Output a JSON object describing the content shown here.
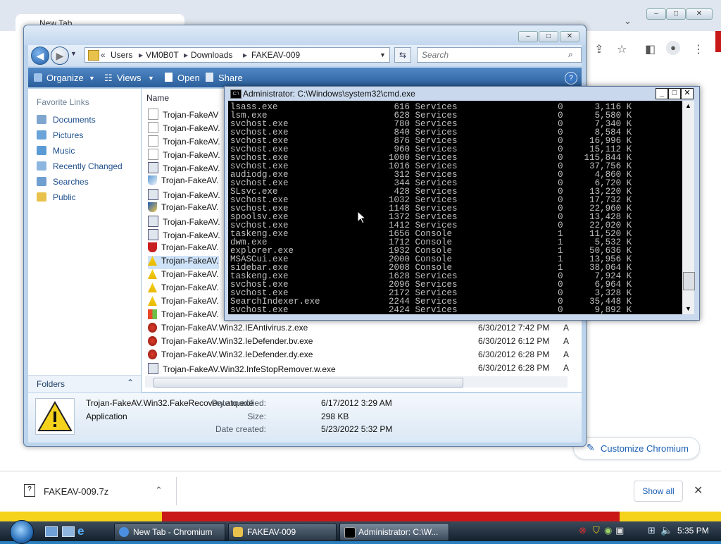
{
  "chrome": {
    "tab_title": "New Tab",
    "customize_label": "Customize Chromium",
    "download_file": "FAKEAV-009.7z",
    "show_all_label": "Show all"
  },
  "explorer": {
    "path": [
      "Users",
      "VM0B0T",
      "Downloads",
      "FAKEAV-009"
    ],
    "search_placeholder": "Search",
    "toolbar": {
      "organize": "Organize",
      "views": "Views",
      "open": "Open",
      "share": "Share"
    },
    "favorites_title": "Favorite Links",
    "favorites": [
      "Documents",
      "Pictures",
      "Music",
      "Recently Changed",
      "Searches",
      "Public"
    ],
    "folders_label": "Folders",
    "column_name": "Name",
    "files": [
      {
        "name": "Trojan-FakeAV",
        "date": "",
        "attr": "",
        "icon": "generic-file-icon"
      },
      {
        "name": "Trojan-FakeAV.",
        "date": "",
        "attr": "",
        "icon": "generic-file-icon"
      },
      {
        "name": "Trojan-FakeAV.",
        "date": "",
        "attr": "",
        "icon": "generic-file-icon"
      },
      {
        "name": "Trojan-FakeAV.",
        "date": "",
        "attr": "",
        "icon": "generic-file-icon"
      },
      {
        "name": "Trojan-FakeAV.",
        "date": "",
        "attr": "",
        "icon": "app-window-icon"
      },
      {
        "name": "Trojan-FakeAV.",
        "date": "",
        "attr": "",
        "icon": "shield-icon"
      },
      {
        "name": "Trojan-FakeAV.",
        "date": "",
        "attr": "",
        "icon": "app-window-icon"
      },
      {
        "name": "Trojan-FakeAV.",
        "date": "",
        "attr": "",
        "icon": "security-shield-icon"
      },
      {
        "name": "Trojan-FakeAV.",
        "date": "",
        "attr": "",
        "icon": "app-window-icon"
      },
      {
        "name": "Trojan-FakeAV.",
        "date": "",
        "attr": "",
        "icon": "app-window-icon"
      },
      {
        "name": "Trojan-FakeAV.",
        "date": "",
        "attr": "",
        "icon": "red-shield-icon"
      },
      {
        "name": "Trojan-FakeAV.",
        "date": "",
        "attr": "",
        "icon": "warning-icon"
      },
      {
        "name": "Trojan-FakeAV.",
        "date": "",
        "attr": "",
        "icon": "warning-icon"
      },
      {
        "name": "Trojan-FakeAV.",
        "date": "",
        "attr": "",
        "icon": "warning-icon"
      },
      {
        "name": "Trojan-FakeAV.",
        "date": "",
        "attr": "",
        "icon": "warning-icon"
      },
      {
        "name": "Trojan-FakeAV.",
        "date": "",
        "attr": "",
        "icon": "windows-flag-icon"
      },
      {
        "name": "Trojan-FakeAV.Win32.IEAntivirus.z.exe",
        "date": "6/30/2012 7:42 PM",
        "attr": "A",
        "icon": "red-app-icon"
      },
      {
        "name": "Trojan-FakeAV.Win32.IeDefender.bv.exe",
        "date": "6/30/2012 6:12 PM",
        "attr": "A",
        "icon": "red-app-icon"
      },
      {
        "name": "Trojan-FakeAV.Win32.IeDefender.dy.exe",
        "date": "6/30/2012 6:28 PM",
        "attr": "A",
        "icon": "red-app-icon"
      },
      {
        "name": "Trojan-FakeAV.Win32.InfeStopRemover.w.exe",
        "date": "6/30/2012 6:28 PM",
        "attr": "A",
        "icon": "app-window-icon"
      }
    ],
    "details": {
      "file_name": "Trojan-FakeAV.Win32.FakeRecovery.atq.exe",
      "file_type": "Application",
      "modified_label": "Date modified:",
      "modified_value": "6/17/2012 3:29 AM",
      "size_label": "Size:",
      "size_value": "298 KB",
      "created_label": "Date created:",
      "created_value": "5/23/2022 5:32 PM"
    }
  },
  "cmd": {
    "title": "Administrator: C:\\Windows\\system32\\cmd.exe",
    "lines": [
      "lsass.exe                      616 Services                   0      3,116 K",
      "lsm.exe                        628 Services                   0      5,580 K",
      "svchost.exe                    780 Services                   0      7,340 K",
      "svchost.exe                    840 Services                   0      8,584 K",
      "svchost.exe                    876 Services                   0     16,996 K",
      "svchost.exe                    960 Services                   0     15,112 K",
      "svchost.exe                   1000 Services                   0    115,844 K",
      "svchost.exe                   1016 Services                   0     37,756 K",
      "audiodg.exe                    312 Services                   0      4,860 K",
      "svchost.exe                    344 Services                   0      6,720 K",
      "SLsvc.exe                      428 Services                   0     13,220 K",
      "svchost.exe                   1032 Services                   0     17,732 K",
      "svchost.exe                   1148 Services                   0     22,960 K",
      "spoolsv.exe                   1372 Services                   0     13,428 K",
      "svchost.exe                   1412 Services                   0     22,020 K",
      "taskeng.exe                   1656 Console                    1     11,520 K",
      "dwm.exe                       1712 Console                    1      5,532 K",
      "explorer.exe                  1932 Console                    1     50,636 K",
      "MSASCui.exe                   2000 Console                    1     13,956 K",
      "sidebar.exe                   2008 Console                    1     38,064 K",
      "taskeng.exe                   1628 Services                   0      7,924 K",
      "svchost.exe                   2096 Services                   0      6,964 K",
      "svchost.exe                   2172 Services                   0      3,328 K",
      "SearchIndexer.exe             2244 Services                   0     35,448 K",
      "svchost.exe                   2424 Services                   0      9,892 K"
    ]
  },
  "taskbar": {
    "items": [
      "New Tab - Chromium",
      "FAKEAV-009",
      "Administrator: C:\\W..."
    ],
    "clock": "5:35 PM"
  }
}
